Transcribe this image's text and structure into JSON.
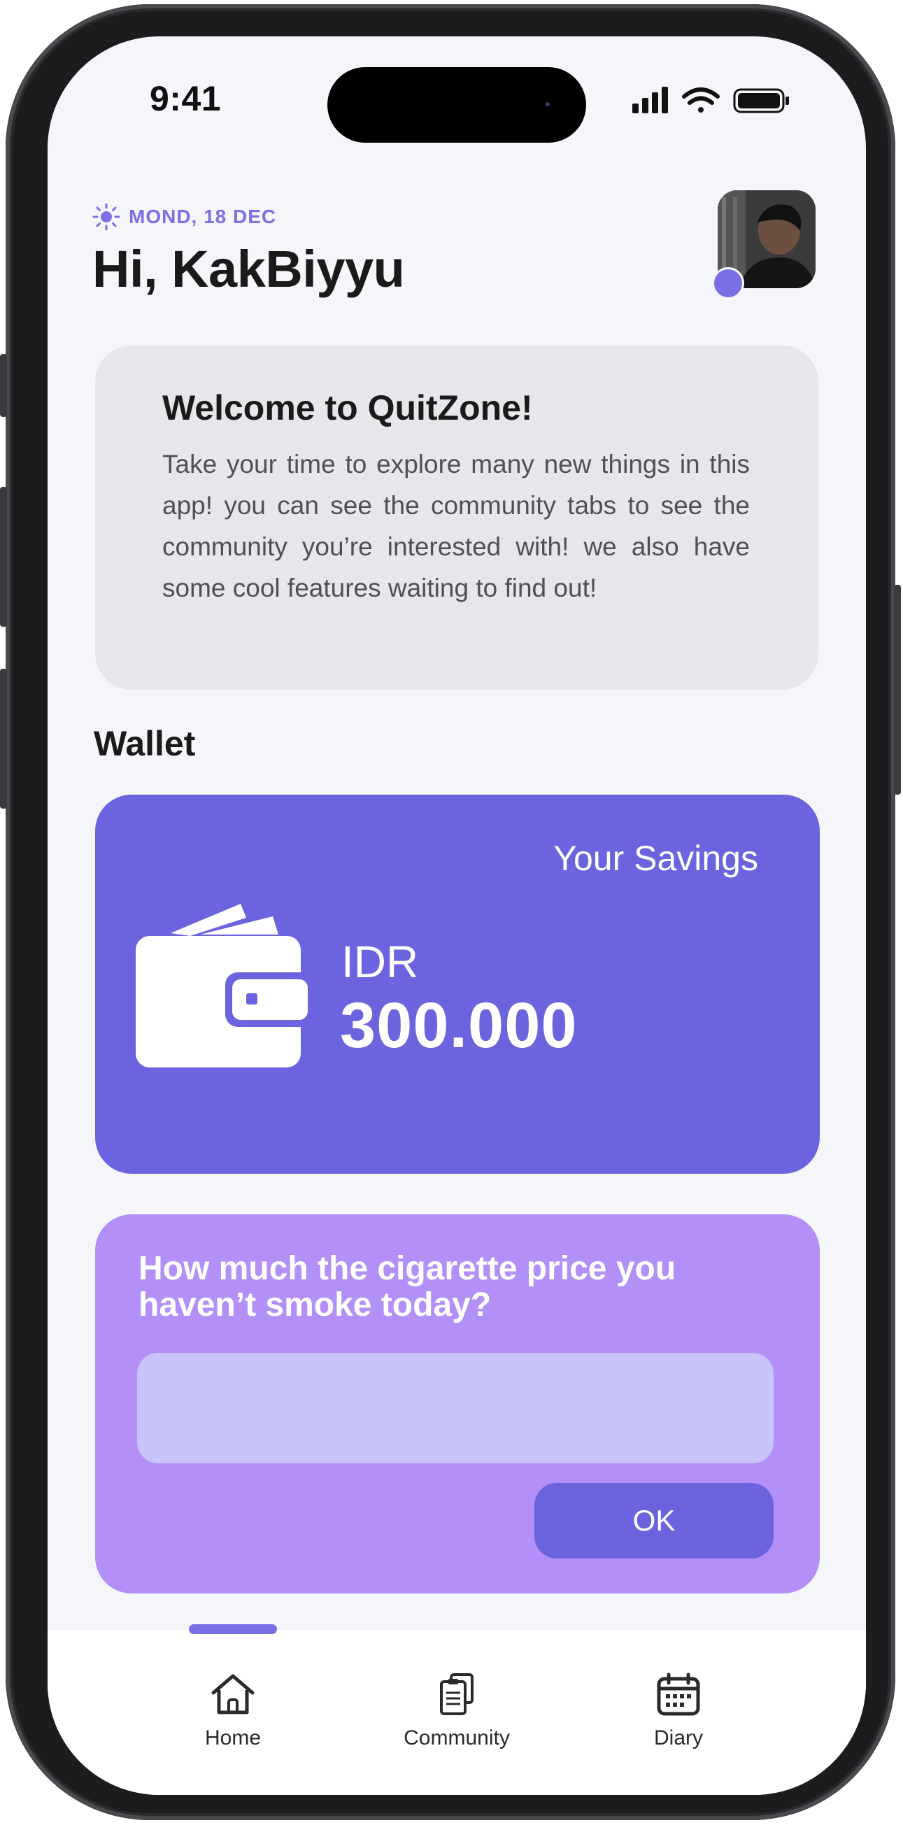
{
  "status_bar": {
    "time": "9:41",
    "icons": [
      "signal-icon",
      "wifi-icon",
      "battery-icon"
    ]
  },
  "header": {
    "date": "MOND, 18 DEC",
    "greeting": "Hi, KakBiyyu",
    "date_icon": "sun-icon"
  },
  "welcome": {
    "title": "Welcome to QuitZone!",
    "body": "Take your time to explore many new things in this app! you can see the community tabs to see the community you’re interested with! we also have some cool features waiting to find out!"
  },
  "wallet": {
    "section_title": "Wallet",
    "label": "Your Savings",
    "currency": "IDR",
    "amount": "300.000"
  },
  "price_prompt": {
    "question": "How much the cigarette price you haven’t smoke today?",
    "input_value": "",
    "button_label": "OK"
  },
  "nav": {
    "items": [
      {
        "label": "Home",
        "icon": "home-icon",
        "active": true
      },
      {
        "label": "Community",
        "icon": "community-icon",
        "active": false
      },
      {
        "label": "Diary",
        "icon": "calendar-icon",
        "active": false
      }
    ]
  },
  "colors": {
    "accent": "#6c63df",
    "accent_light": "#b38ff8",
    "input_bg": "#c9c3fb",
    "date_text": "#7b6fe6",
    "card_bg": "#e7e7eb"
  }
}
